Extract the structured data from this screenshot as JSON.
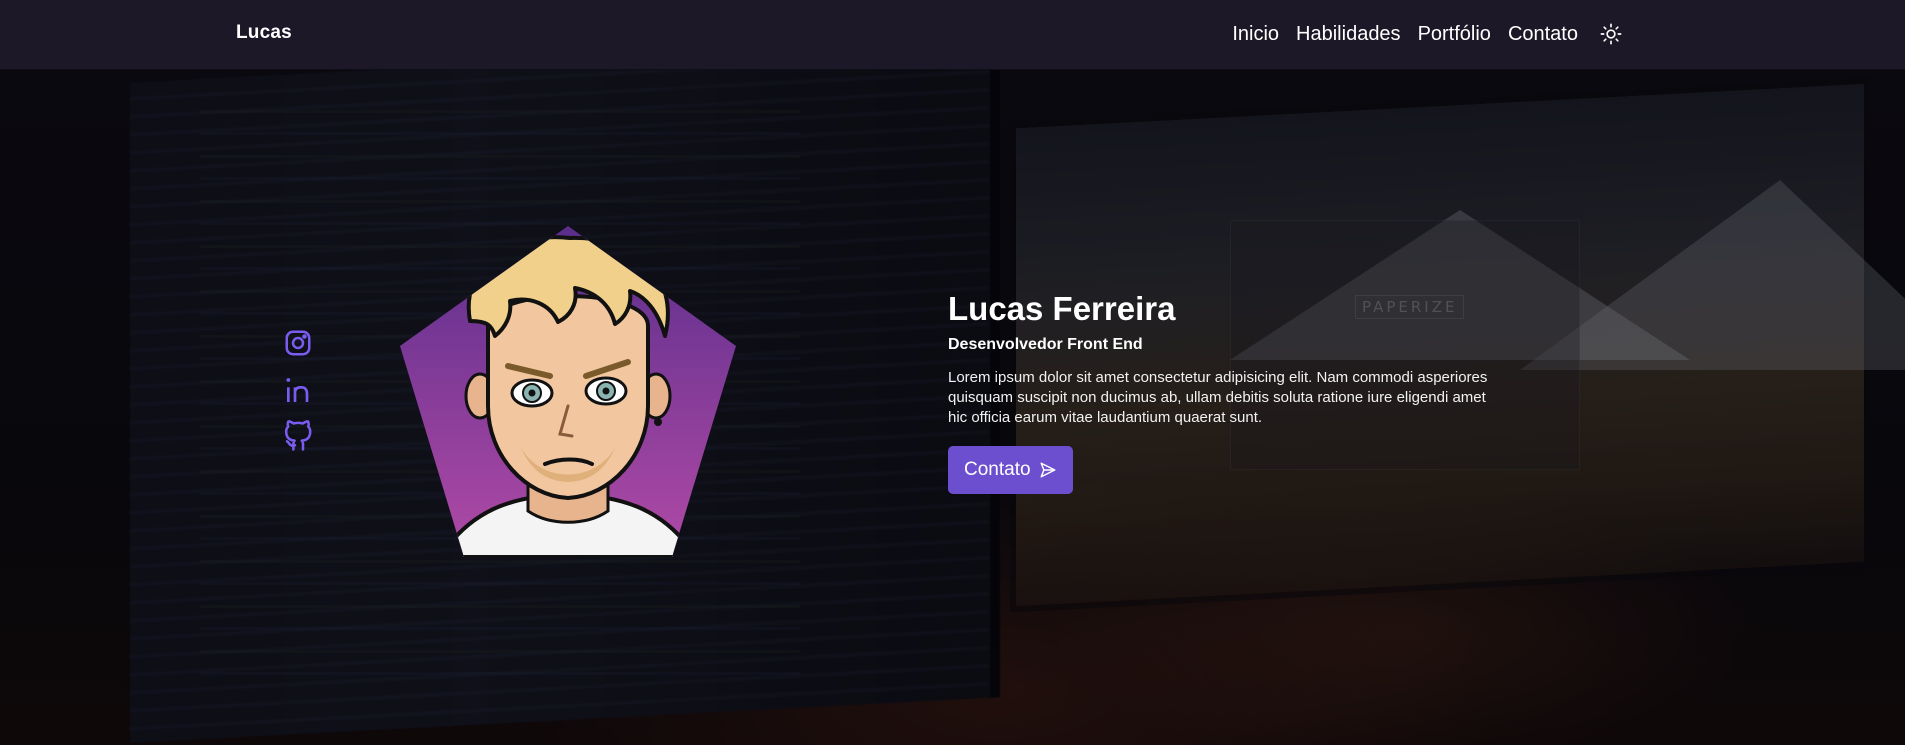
{
  "navbar": {
    "brand": "Lucas",
    "links": [
      "Inicio",
      "Habilidades",
      "Portfólio",
      "Contato"
    ],
    "theme_icon": "sun-icon"
  },
  "hero": {
    "name": "Lucas Ferreira",
    "role": "Desenvolvedor Front End",
    "description": "Lorem ipsum dolor sit amet consectetur adipisicing elit. Nam commodi asperiores quisquam suscipit non ducimus ab, ullam debitis soluta ratione iure eligendi amet hic officia earum vitae laudantium quaerat sunt.",
    "cta_label": "Contato",
    "cta_icon": "send-icon",
    "background_screen_text": "PAPERIZE"
  },
  "social": [
    {
      "name": "instagram-icon"
    },
    {
      "name": "linkedin-icon"
    },
    {
      "name": "github-icon"
    }
  ],
  "colors": {
    "navbar_bg": "#1c1827",
    "accent": "#6b4fcf",
    "icon_accent": "#7b5cf0",
    "avatar_gradient_top": "#5b2e8c",
    "avatar_gradient_bottom": "#b04aa6"
  }
}
